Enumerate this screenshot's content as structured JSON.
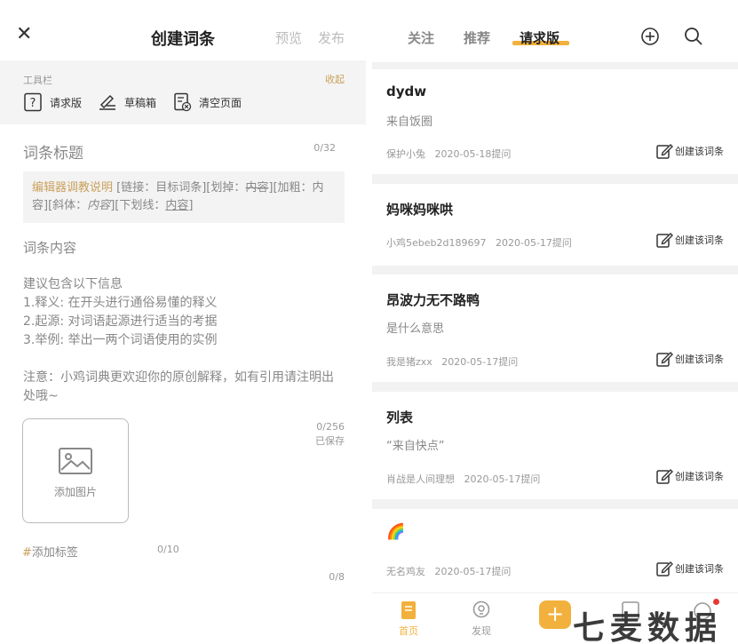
{
  "left": {
    "header": {
      "title": "创建词条",
      "preview": "预览",
      "publish": "发布"
    },
    "toolbar": {
      "label": "工具栏",
      "collapse": "收起",
      "buttons": [
        {
          "label": "请求版",
          "icon": "question-box-icon"
        },
        {
          "label": "草稿箱",
          "icon": "pen-line-icon"
        },
        {
          "label": "清空页面",
          "icon": "clear-page-icon"
        }
      ]
    },
    "entry_title": {
      "placeholder": "词条标题",
      "count": "0/32"
    },
    "guide": {
      "link_text": "编辑器调教说明",
      "p1": " [链接：目标词条][划掉：",
      "strike": "内容",
      "p2": "][加粗：",
      "bold": "内容",
      "p3": "][斜体：",
      "italic": "内容",
      "p4": "][下划线：",
      "underline": "内容",
      "p5": "]"
    },
    "content": {
      "label": "词条内容",
      "hint_lines": [
        "建议包含以下信息",
        "1.释义: 在开头进行通俗易懂的释义",
        "2.起源: 对词语起源进行适当的考据",
        "3.举例: 举出一两个词语使用的实例"
      ],
      "note": "注意：小鸡词典更欢迎你的原创解释，如有引用请注明出处哦~",
      "count": "0/256",
      "saved": "已保存"
    },
    "image": {
      "label": "添加图片"
    },
    "tags": {
      "hash": "#",
      "label": "添加标签",
      "count": "0/10"
    },
    "bottom_count": "0/8"
  },
  "right": {
    "tabs": [
      {
        "label": "关注",
        "active": false
      },
      {
        "label": "推荐",
        "active": false
      },
      {
        "label": "请求版",
        "active": true
      }
    ],
    "cards": [
      {
        "title": "dydw",
        "subtitle": "来自饭圈",
        "user": "保护小兔",
        "date": "2020-05-18提问",
        "action": "创建该词条"
      },
      {
        "title": "妈咪妈咪哄",
        "subtitle": "",
        "user": "小鸡5ebeb2d189697",
        "date": "2020-05-17提问",
        "action": "创建该词条"
      },
      {
        "title": "昂波力无不路鸭",
        "subtitle": "是什么意思",
        "user": "我是猪zxx",
        "date": "2020-05-17提问",
        "action": "创建该词条"
      },
      {
        "title": "列表",
        "subtitle": "“来自快点”",
        "user": "肖战是人间理想",
        "date": "2020-05-17提问",
        "action": "创建该词条"
      },
      {
        "title": "🌈",
        "subtitle": "",
        "user": "无名鸡友",
        "date": "2020-05-17提问",
        "action": "创建该词条"
      }
    ],
    "nav": {
      "home": "首页",
      "discover": "发现"
    }
  },
  "watermark": "七麦数据",
  "colors": {
    "accent": "#f2b13c",
    "link": "#c9a15d",
    "muted": "#999999"
  }
}
